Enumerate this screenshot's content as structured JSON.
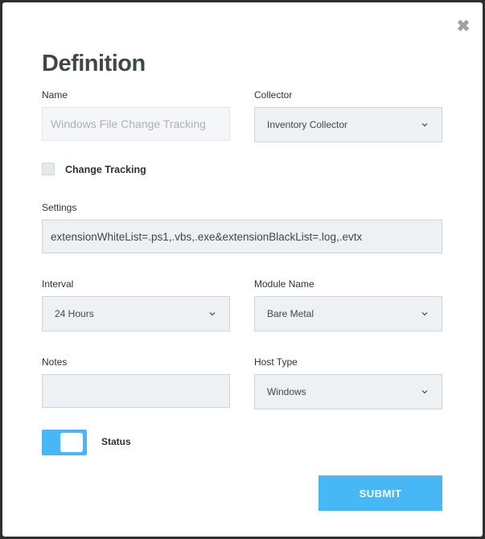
{
  "dialog": {
    "title": "Definition",
    "close_icon": "close-icon"
  },
  "form": {
    "name": {
      "label": "Name",
      "value": "Windows File Change Tracking"
    },
    "collector": {
      "label": "Collector",
      "value": "Inventory Collector"
    },
    "change_tracking": {
      "label": "Change Tracking",
      "checked": false
    },
    "settings": {
      "label": "Settings",
      "value": "extensionWhiteList=.ps1,.vbs,.exe&extensionBlackList=.log,.evtx"
    },
    "interval": {
      "label": "Interval",
      "value": "24 Hours"
    },
    "module_name": {
      "label": "Module Name",
      "value": "Bare Metal"
    },
    "notes": {
      "label": "Notes",
      "value": ""
    },
    "host_type": {
      "label": "Host Type",
      "value": "Windows"
    },
    "status": {
      "label": "Status",
      "enabled": true
    }
  },
  "actions": {
    "submit_label": "SUBMIT"
  },
  "colors": {
    "accent": "#47b8f5",
    "field_bg": "#eef1f4",
    "title": "#3d474d"
  }
}
